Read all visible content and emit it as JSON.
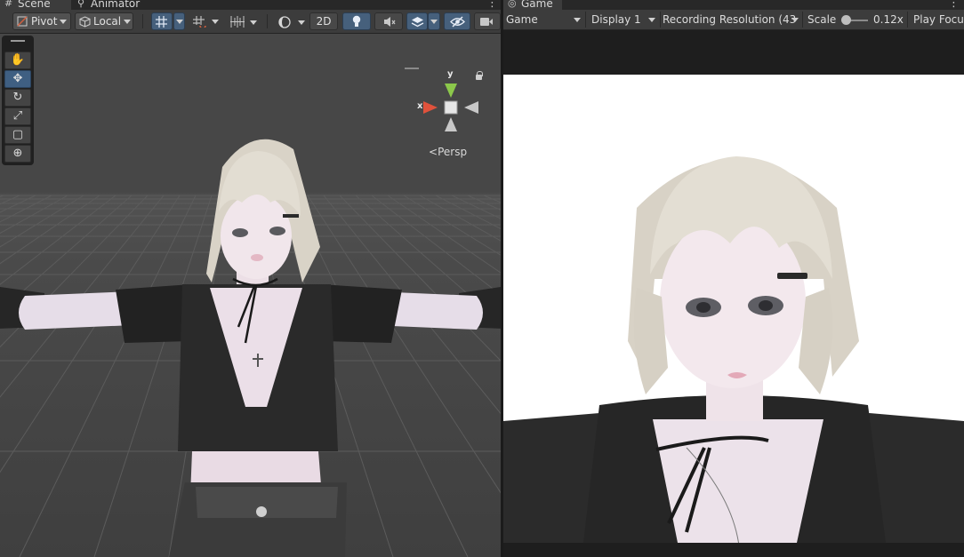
{
  "tabs": {
    "scene": {
      "label": "Scene",
      "icon": "hash-icon"
    },
    "animator": {
      "label": "Animator",
      "icon": "animator-icon"
    },
    "game": {
      "label": "Game",
      "icon": "gamepad-icon"
    }
  },
  "scene_toolbar": {
    "pivot_label": "Pivot",
    "local_label": "Local",
    "mode_2d_label": "2D"
  },
  "scene_view": {
    "tools": [
      "hand-tool",
      "move-tool",
      "rotate-tool",
      "scale-tool",
      "rect-tool",
      "transform-tool"
    ],
    "active_tool": "move-tool",
    "gizmo": {
      "y_label": "y",
      "x_label": "x"
    },
    "projection_label": "Persp"
  },
  "game_toolbar": {
    "view_label": "Game",
    "display_label": "Display 1",
    "resolution_label": "Recording Resolution (43",
    "scale_label": "Scale",
    "scale_value": "0.12x",
    "play_focus_label": "Play Focu"
  },
  "colors": {
    "accent_blue": "#46607c",
    "gizmo_y": "#8cc84b",
    "gizmo_x": "#e0523c",
    "panel_bg": "#3c3c3c",
    "viewport_bg": "#474747"
  }
}
